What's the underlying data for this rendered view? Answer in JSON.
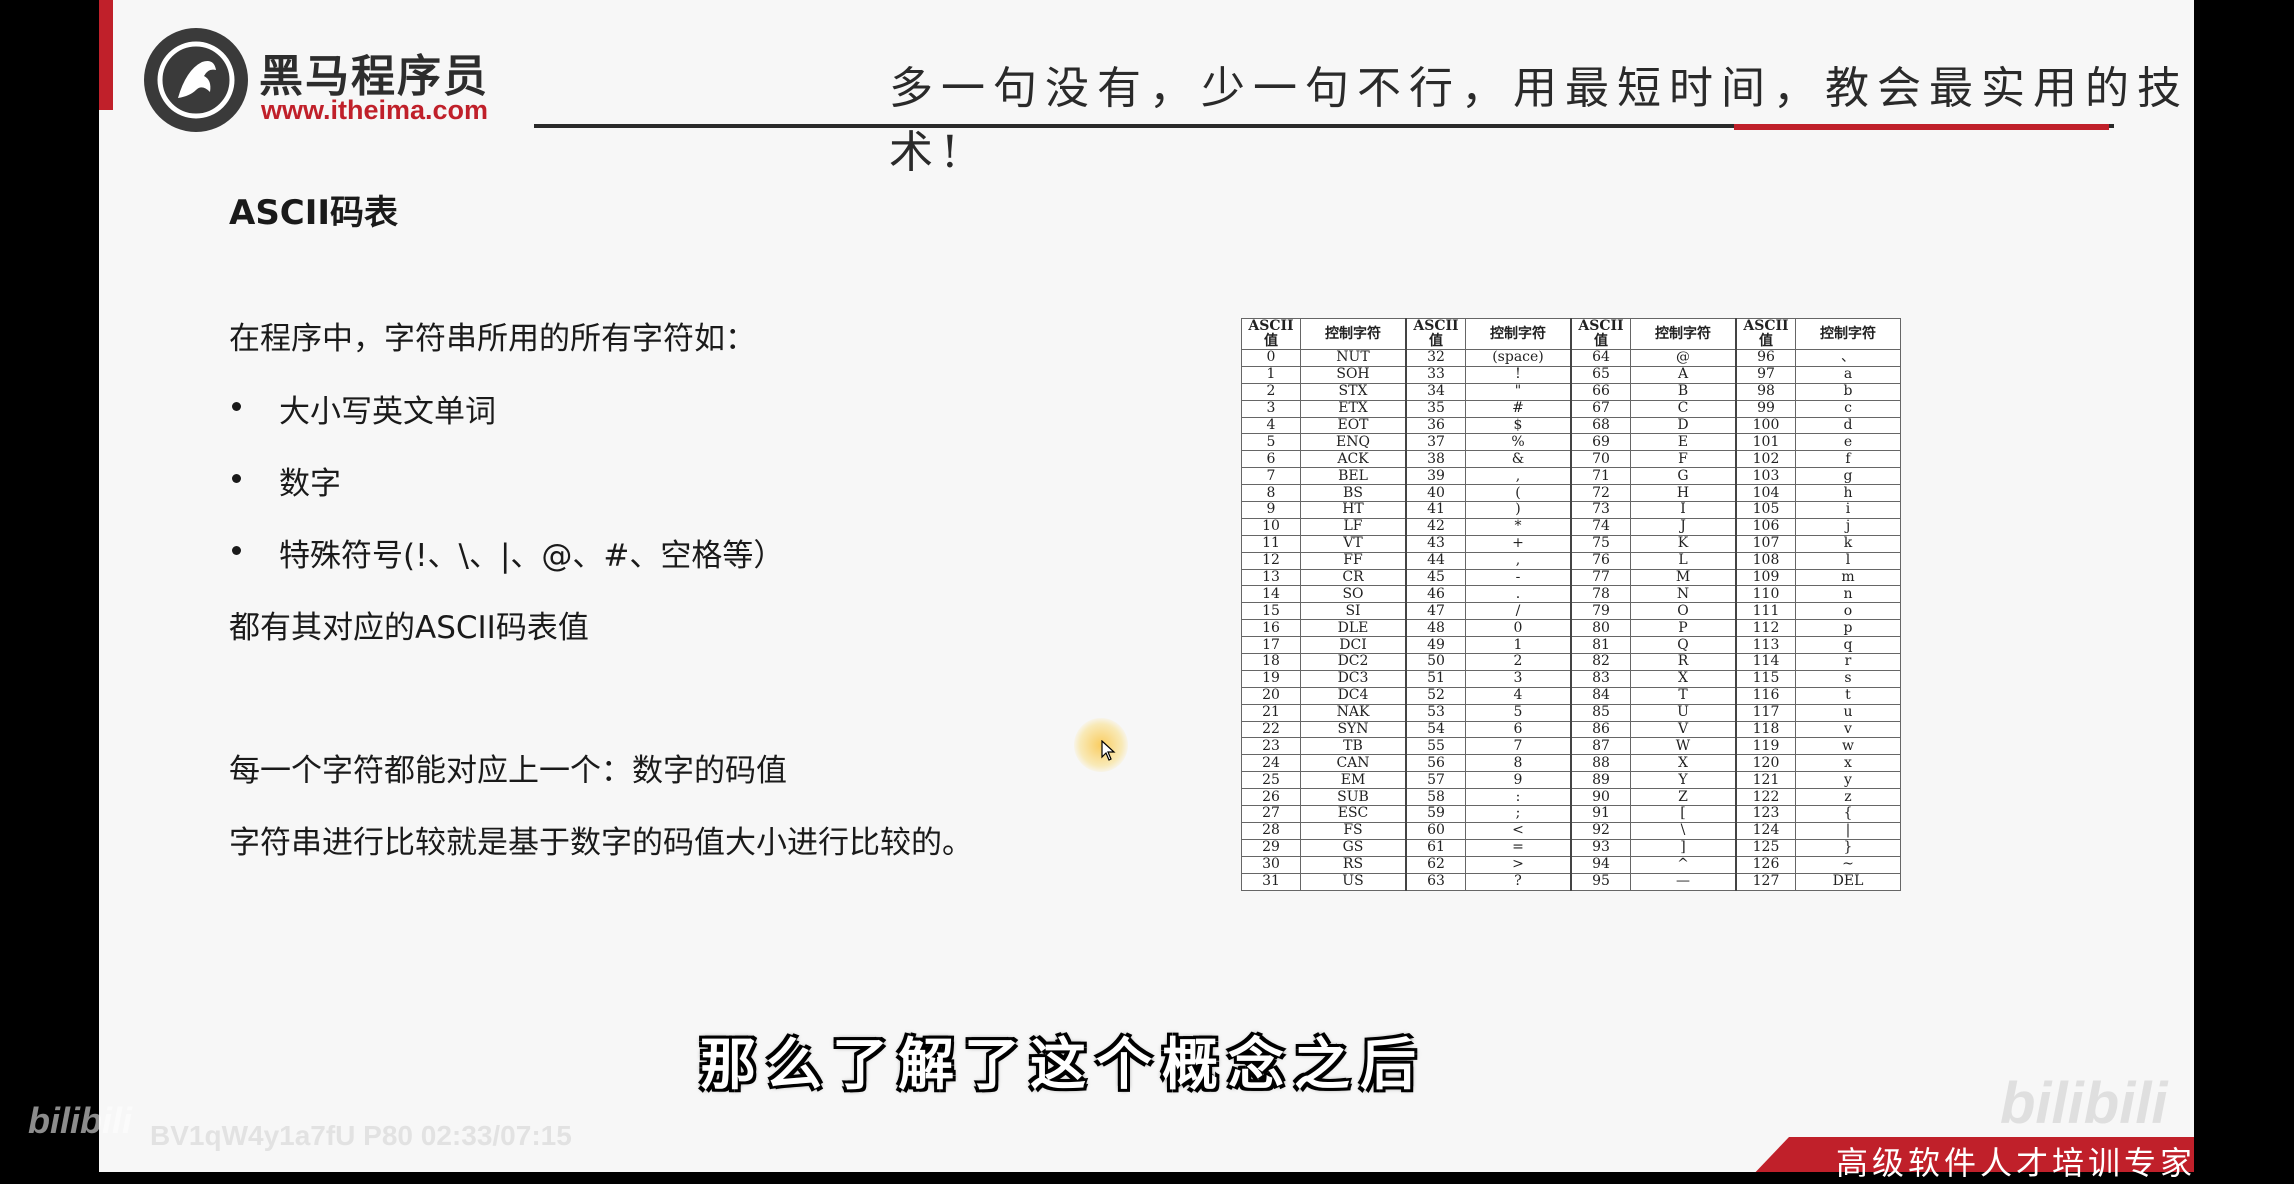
{
  "header": {
    "brand_name": "黑马程序员",
    "brand_url": "www.itheima.com",
    "slogan": "多一句没有，少一句不行，用最短时间，教会最实用的技术!"
  },
  "slide": {
    "title": "ASCII码表",
    "intro": "在程序中，字符串所用的所有字符如：",
    "bullets": [
      "大小写英文单词",
      "数字",
      "特殊符号(!、\\、|、@、#、空格等）"
    ],
    "summary": "都有其对应的ASCII码表值",
    "note1": "每一个字符都能对应上一个：数字的码值",
    "note2": "字符串进行比较就是基于数字的码值大小进行比较的。"
  },
  "ascii_table": {
    "headers": [
      "ASCII值",
      "控制字符",
      "ASCII值",
      "控制字符",
      "ASCII值",
      "控制字符",
      "ASCII值",
      "控制字符"
    ],
    "rows": [
      [
        "0",
        "NUT",
        "32",
        "(space)",
        "64",
        "@",
        "96",
        "、"
      ],
      [
        "1",
        "SOH",
        "33",
        "!",
        "65",
        "A",
        "97",
        "a"
      ],
      [
        "2",
        "STX",
        "34",
        "\"",
        "66",
        "B",
        "98",
        "b"
      ],
      [
        "3",
        "ETX",
        "35",
        "#",
        "67",
        "C",
        "99",
        "c"
      ],
      [
        "4",
        "EOT",
        "36",
        "$",
        "68",
        "D",
        "100",
        "d"
      ],
      [
        "5",
        "ENQ",
        "37",
        "%",
        "69",
        "E",
        "101",
        "e"
      ],
      [
        "6",
        "ACK",
        "38",
        "&",
        "70",
        "F",
        "102",
        "f"
      ],
      [
        "7",
        "BEL",
        "39",
        ",",
        "71",
        "G",
        "103",
        "g"
      ],
      [
        "8",
        "BS",
        "40",
        "(",
        "72",
        "H",
        "104",
        "h"
      ],
      [
        "9",
        "HT",
        "41",
        ")",
        "73",
        "I",
        "105",
        "i"
      ],
      [
        "10",
        "LF",
        "42",
        "*",
        "74",
        "J",
        "106",
        "j"
      ],
      [
        "11",
        "VT",
        "43",
        "+",
        "75",
        "K",
        "107",
        "k"
      ],
      [
        "12",
        "FF",
        "44",
        ",",
        "76",
        "L",
        "108",
        "l"
      ],
      [
        "13",
        "CR",
        "45",
        "-",
        "77",
        "M",
        "109",
        "m"
      ],
      [
        "14",
        "SO",
        "46",
        ".",
        "78",
        "N",
        "110",
        "n"
      ],
      [
        "15",
        "SI",
        "47",
        "/",
        "79",
        "O",
        "111",
        "o"
      ],
      [
        "16",
        "DLE",
        "48",
        "0",
        "80",
        "P",
        "112",
        "p"
      ],
      [
        "17",
        "DCI",
        "49",
        "1",
        "81",
        "Q",
        "113",
        "q"
      ],
      [
        "18",
        "DC2",
        "50",
        "2",
        "82",
        "R",
        "114",
        "r"
      ],
      [
        "19",
        "DC3",
        "51",
        "3",
        "83",
        "X",
        "115",
        "s"
      ],
      [
        "20",
        "DC4",
        "52",
        "4",
        "84",
        "T",
        "116",
        "t"
      ],
      [
        "21",
        "NAK",
        "53",
        "5",
        "85",
        "U",
        "117",
        "u"
      ],
      [
        "22",
        "SYN",
        "54",
        "6",
        "86",
        "V",
        "118",
        "v"
      ],
      [
        "23",
        "TB",
        "55",
        "7",
        "87",
        "W",
        "119",
        "w"
      ],
      [
        "24",
        "CAN",
        "56",
        "8",
        "88",
        "X",
        "120",
        "x"
      ],
      [
        "25",
        "EM",
        "57",
        "9",
        "89",
        "Y",
        "121",
        "y"
      ],
      [
        "26",
        "SUB",
        "58",
        ":",
        "90",
        "Z",
        "122",
        "z"
      ],
      [
        "27",
        "ESC",
        "59",
        ";",
        "91",
        "[",
        "123",
        "{"
      ],
      [
        "28",
        "FS",
        "60",
        "<",
        "92",
        "\\",
        "124",
        "|"
      ],
      [
        "29",
        "GS",
        "61",
        "=",
        "93",
        "]",
        "125",
        "}"
      ],
      [
        "30",
        "RS",
        "62",
        ">",
        "94",
        "^",
        "126",
        "~"
      ],
      [
        "31",
        "US",
        "63",
        "?",
        "95",
        "—",
        "127",
        "DEL"
      ]
    ]
  },
  "subtitle": "那么了解了这个概念之后",
  "footer": {
    "text": "高级软件人才培训专家"
  },
  "player": {
    "bili_logo": "bilibili",
    "video_info": "BV1qW4y1a7fU P80 02:33/07:15",
    "watermark": "bilibili"
  },
  "colors": {
    "brand_red": "#c0202a",
    "slide_bg": "#f7f7f7"
  }
}
